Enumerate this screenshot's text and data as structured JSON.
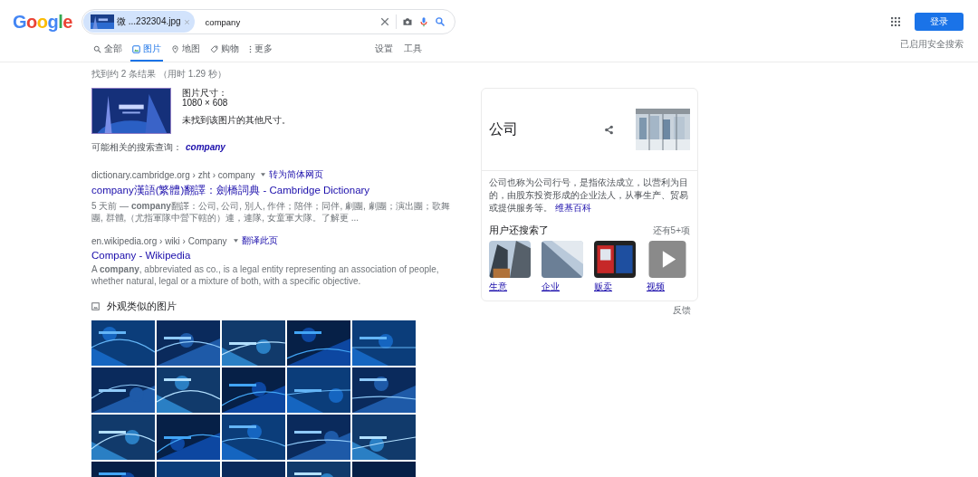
{
  "logo": "Google",
  "search": {
    "chip_file": "微 ...232304.jpg",
    "query": "company"
  },
  "sign_in": "登录",
  "tabs": [
    {
      "label": "全部",
      "selected": false
    },
    {
      "label": "图片",
      "selected": true
    },
    {
      "label": "地图",
      "selected": false
    },
    {
      "label": "购物",
      "selected": false
    },
    {
      "label": "更多",
      "selected": false
    }
  ],
  "tools": [
    "设置",
    "工具"
  ],
  "safe_search": "已启用安全搜索",
  "stats": "找到约 2 条结果 （用时 1.29 秒）",
  "image_info": {
    "size_label": "图片尺寸：",
    "size": "1080 × 608",
    "note": "未找到该图片的其他尺寸。"
  },
  "related": {
    "label": "可能相关的搜索查询：",
    "query": "company"
  },
  "results": [
    {
      "url": "dictionary.cambridge.org › zht › company",
      "translate": "转为简体网页",
      "title": "company漢語(繁體)翻譯：劍橋詞典 - Cambridge Dictionary",
      "snippet": "5 天前 — **company**翻譯：公司, 公司, 別人, 作伴；陪伴；同伴, 劇團, 劇團；演出團；歌舞團, 群體,（尤指軍隊中營下轄的）連，連隊, 女童軍大隊。了解更 ..."
    },
    {
      "url": "en.wikipedia.org › wiki › Company",
      "translate": "翻译此页",
      "title": "Company - Wikipedia",
      "snippet": "A **company**, abbreviated as co., is a legal entity representing an association of people, whether natural, legal or a mixture of both, with a specific objective."
    }
  ],
  "similar": {
    "heading": "外观类似的图片"
  },
  "panel": {
    "title": "公司",
    "description": "公司也称为公司行号，是指依法成立，以营利为目的，由股东投资形成的企业法人，从事生产、贸易或提供服务等。",
    "source": "维基百科",
    "also_heading": "用户还搜索了",
    "more": "还有5+项",
    "items": [
      {
        "label": "生意",
        "kind": "picture"
      },
      {
        "label": "企业",
        "kind": "picture"
      },
      {
        "label": "贩卖",
        "kind": "picture"
      },
      {
        "label": "视频",
        "kind": "video"
      }
    ],
    "feedback": "反馈"
  }
}
